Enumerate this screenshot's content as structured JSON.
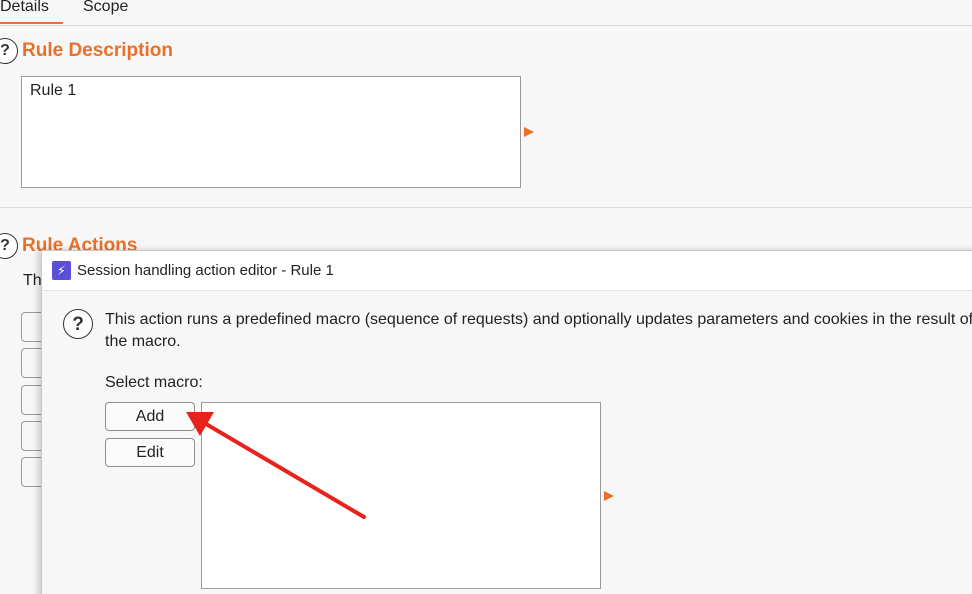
{
  "tabs": [
    {
      "label": "Details",
      "active": true
    },
    {
      "label": "Scope",
      "active": false
    }
  ],
  "rule_description": {
    "heading": "Rule Description",
    "value": "Rule 1"
  },
  "rule_actions": {
    "heading": "Rule Actions",
    "text_fragment": "Th"
  },
  "dialog": {
    "title": "Session handling action editor - Rule 1",
    "app_icon_glyph": "⚡",
    "info_text": "This action runs a predefined macro (sequence of requests) and optionally updates parameters and cookies in the result of the macro.",
    "select_macro_label": "Select macro:",
    "add_button": "Add",
    "edit_button": "Edit"
  },
  "icons": {
    "help": "?"
  },
  "colors": {
    "accent_orange": "#e8702a",
    "annotation_red": "#e8231b",
    "app_icon_purple": "#5a4fd6"
  }
}
